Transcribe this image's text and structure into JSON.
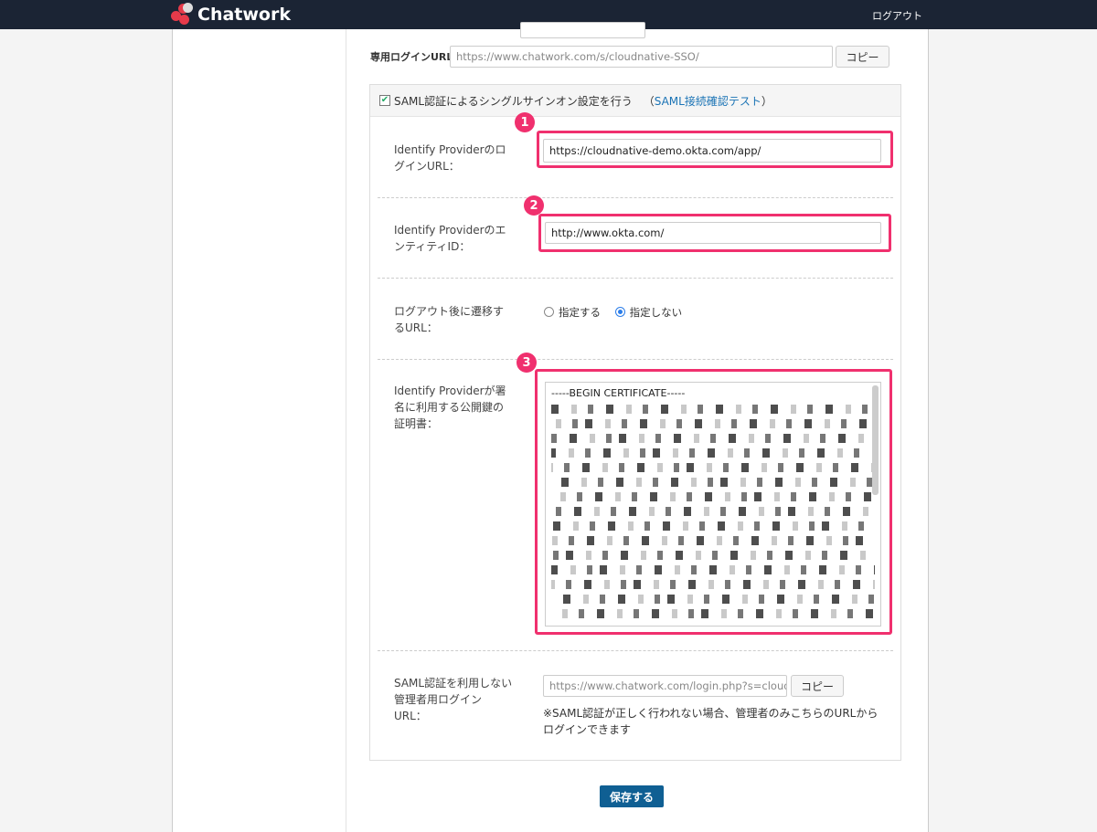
{
  "header": {
    "brand": "Chatwork",
    "logout": "ログアウト"
  },
  "login_url": {
    "label": "専用ログインURL:",
    "value": "https://www.chatwork.com/s/cloudnative-SSO/",
    "copy": "コピー"
  },
  "saml": {
    "checkbox_label": "SAML認証によるシングルサインオン設定を行う",
    "test_link": "SAML接続確認テスト",
    "idp_login_url": {
      "label": "Identify ProviderのログインURL：",
      "value": "https://cloudnative-demo.okta.com/app/",
      "marker": "1"
    },
    "entity_id": {
      "label": "Identify ProviderのエンティティID：",
      "value": "http://www.okta.com/",
      "marker": "2"
    },
    "logout_redirect": {
      "label": "ログアウト後に遷移するURL：",
      "options": [
        "指定する",
        "指定しない"
      ],
      "selected": "指定しない"
    },
    "certificate": {
      "label": "Identify Providerが署名に利用する公開鍵の証明書：",
      "value": "-----BEGIN CERTIFICATE-----",
      "marker": "3"
    },
    "admin_login": {
      "label": "SAML認証を利用しない管理者用ログインURL：",
      "value": "https://www.chatwork.com/login.php?s=cloudnati",
      "copy": "コピー",
      "note": "※SAML認証が正しく行われない場合、管理者のみこちらのURLからログインできます"
    }
  },
  "save": "保存する",
  "colors": {
    "accent": "#f0306e",
    "primary": "#0f5f93",
    "topbar": "#1b2434"
  }
}
